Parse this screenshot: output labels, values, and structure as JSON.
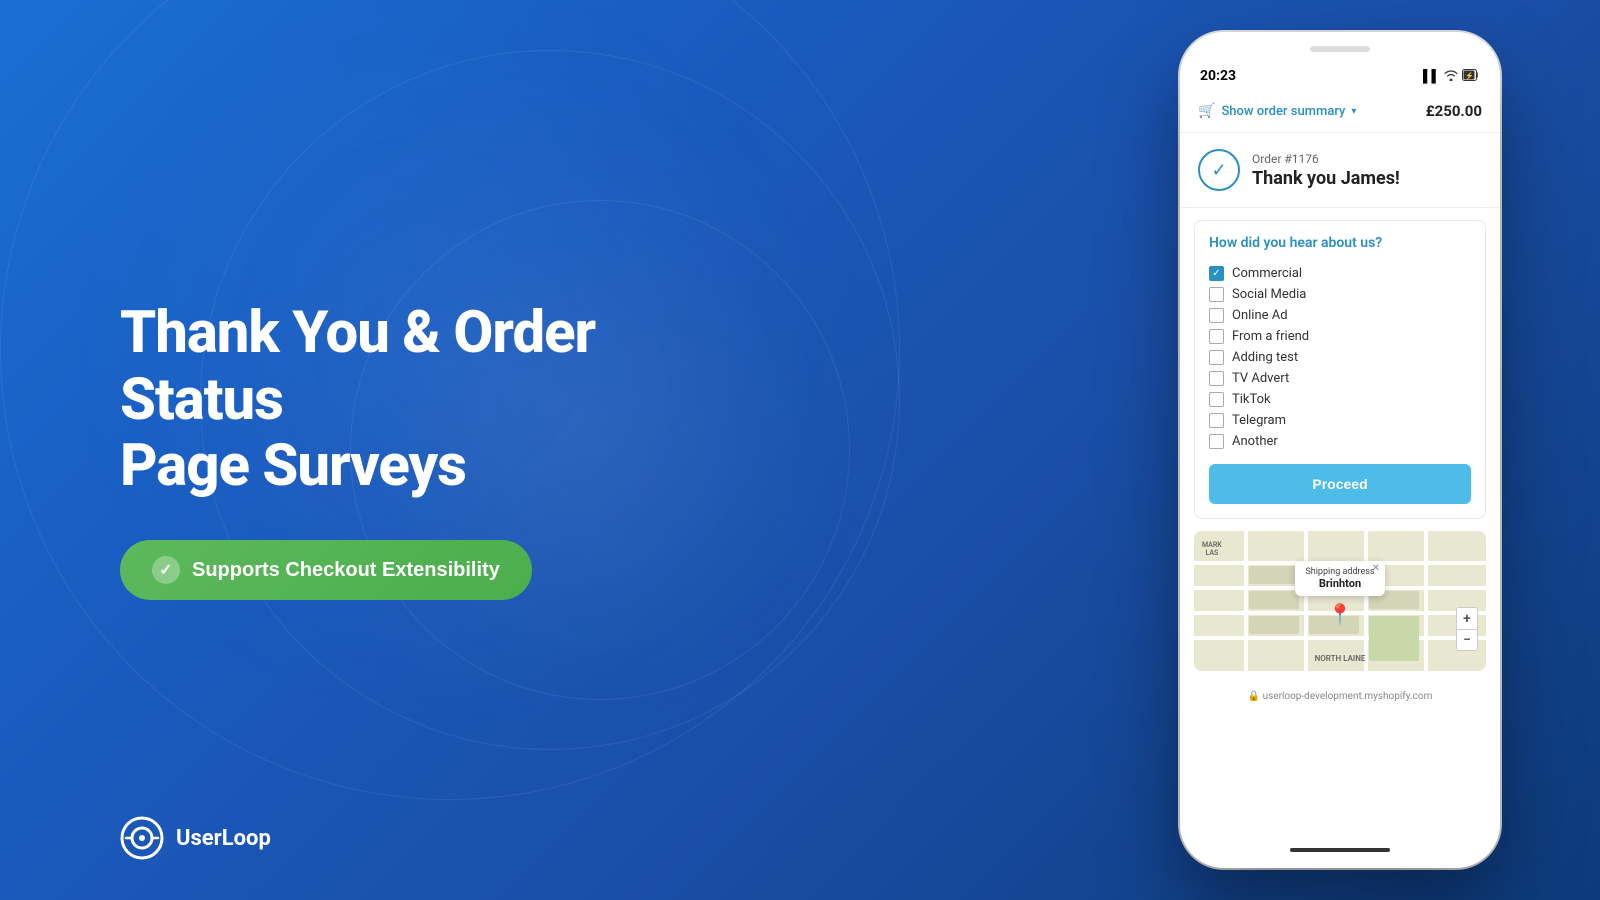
{
  "background": {
    "gradient_start": "#1a6fd4",
    "gradient_end": "#0d3a7a"
  },
  "left_content": {
    "title_line1": "Thank You & Order Status",
    "title_line2": "Page Surveys",
    "badge_label": "Supports Checkout Extensibility"
  },
  "logo": {
    "name": "UserLoop"
  },
  "phone": {
    "status_bar": {
      "time": "20:23",
      "signal": "▌▌",
      "wifi": "WiFi",
      "battery": "⚡"
    },
    "order_summary": {
      "label": "Show order summary",
      "price": "£250.00"
    },
    "thank_you": {
      "order_number": "Order #1176",
      "message": "Thank you James!"
    },
    "survey": {
      "question": "How did you hear about us?",
      "options": [
        {
          "label": "Commercial",
          "checked": true
        },
        {
          "label": "Social Media",
          "checked": false
        },
        {
          "label": "Online Ad",
          "checked": false
        },
        {
          "label": "From a friend",
          "checked": false
        },
        {
          "label": "Adding test",
          "checked": false
        },
        {
          "label": "TV Advert",
          "checked": false
        },
        {
          "label": "TikTok",
          "checked": false
        },
        {
          "label": "Telegram",
          "checked": false
        },
        {
          "label": "Another",
          "checked": false
        }
      ],
      "proceed_button": "Proceed"
    },
    "map": {
      "shipping_address_label": "Shipping address",
      "city": "Brinhton",
      "area_label": "NORTH LAINE"
    },
    "url_bar": "userloop-development.myshopify.com"
  }
}
